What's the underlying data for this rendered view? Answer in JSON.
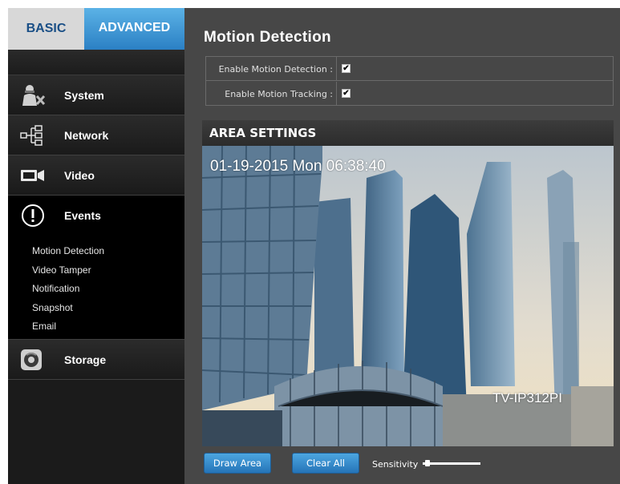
{
  "sidebar": {
    "mode_tabs": {
      "basic": "BASIC",
      "advanced": "ADVANCED"
    },
    "items": [
      {
        "label": "System",
        "icon": "system-settings-icon"
      },
      {
        "label": "Network",
        "icon": "network-icon"
      },
      {
        "label": "Video",
        "icon": "video-camera-icon"
      },
      {
        "label": "Events",
        "icon": "alert-icon",
        "submenu": [
          "Motion Detection",
          "Video Tamper",
          "Notification",
          "Snapshot",
          "Email"
        ]
      },
      {
        "label": "Storage",
        "icon": "storage-disk-icon"
      }
    ]
  },
  "main": {
    "title": "Motion Detection",
    "options": [
      {
        "label": "Enable Motion Detection :",
        "checked": true
      },
      {
        "label": "Enable Motion Tracking :",
        "checked": true
      }
    ],
    "area_settings": {
      "header": "AREA SETTINGS",
      "timestamp": "01-19-2015 Mon  06:38:40",
      "camera_model": "TV-IP312PI"
    },
    "buttons": {
      "draw_area": "Draw Area",
      "clear_all": "Clear All"
    },
    "sensitivity": {
      "label": "Sensitivity",
      "value": 0.05
    }
  },
  "colors": {
    "accent": "#2b80c4",
    "sidebar_bg": "#151515",
    "main_bg": "#474747"
  }
}
